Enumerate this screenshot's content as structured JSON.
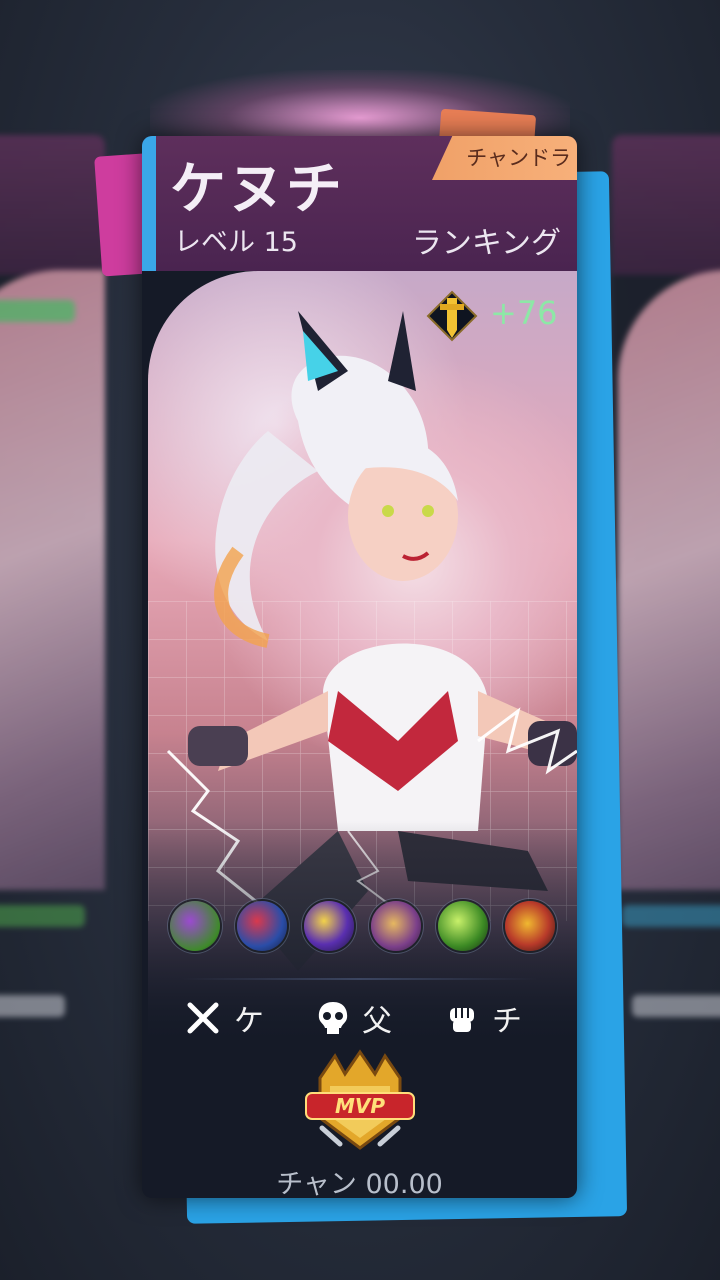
{
  "card": {
    "hero_name": "ケヌチ",
    "level": "レベル 15",
    "ranking": "ランキング",
    "role_tag": "チャンドラ",
    "medal_value": "+76",
    "stats": [
      {
        "icon": "crossed-swords-icon",
        "value": "ケ"
      },
      {
        "icon": "skull-icon",
        "value": "父"
      },
      {
        "icon": "fist-icon",
        "value": "チ"
      }
    ],
    "mvp_label": "MVP",
    "score": "チャン 00.00",
    "items": [
      "boots-item-icon",
      "blade-item-icon",
      "spear-item-icon",
      "shield-item-icon",
      "claw-item-icon",
      "armor-item-icon"
    ]
  },
  "colors": {
    "header": "#4a2450",
    "accent_blue": "#2aa3e6",
    "accent_pink": "#ce3d9e",
    "role_tag": "#f0a168",
    "medal_value": "#8de8a6"
  }
}
